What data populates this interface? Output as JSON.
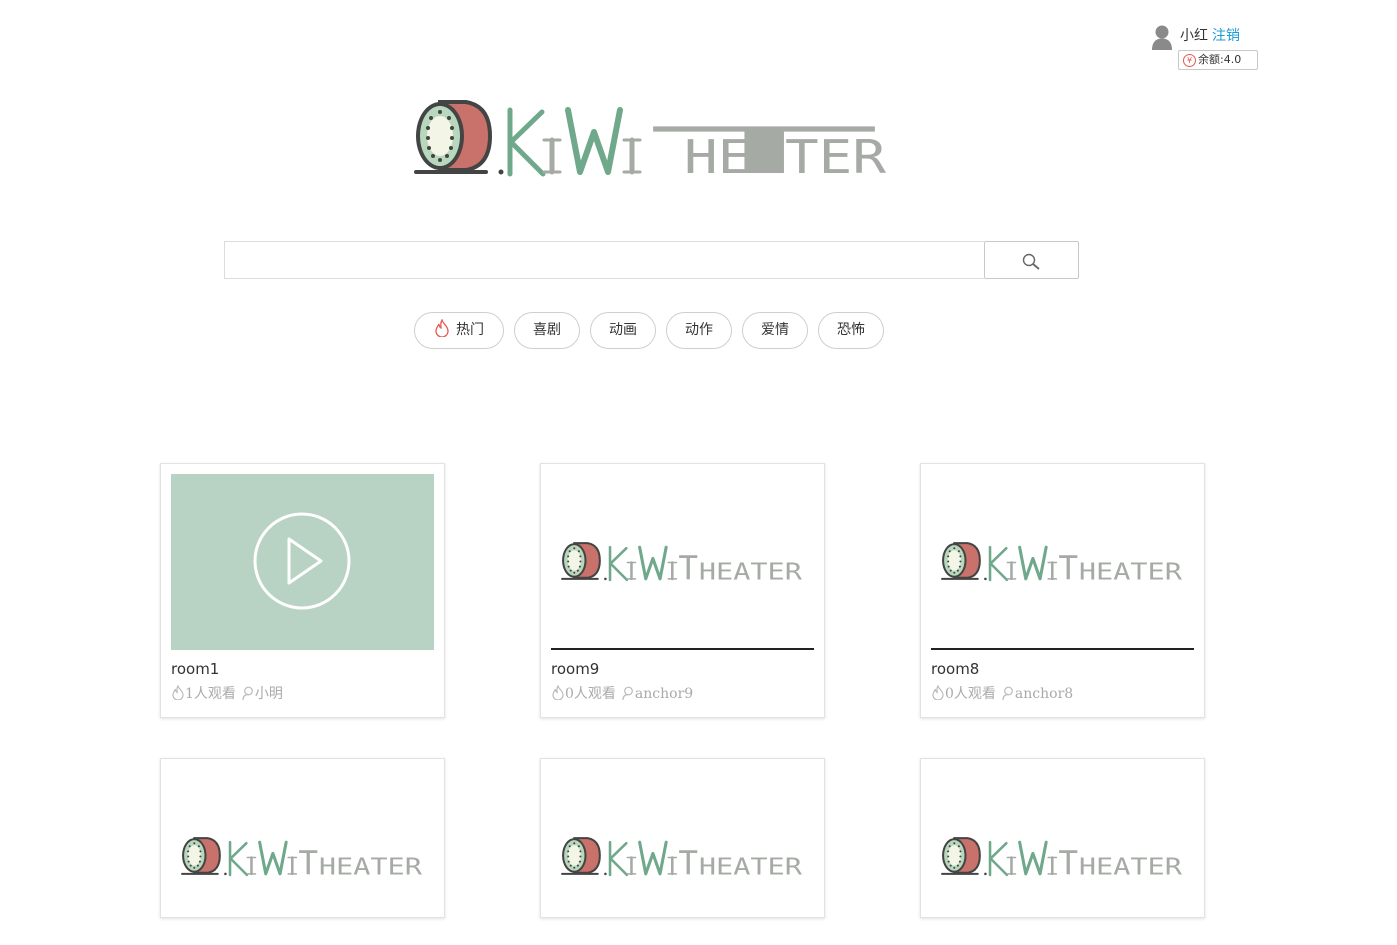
{
  "user": {
    "name": "小红",
    "logout_label": "注销",
    "balance_label": "余额:",
    "balance_value": "4.0"
  },
  "logo": {
    "alt": "KiWiTheater"
  },
  "search": {
    "value": "",
    "placeholder": ""
  },
  "categories": [
    {
      "label": "热门",
      "icon": "fire-icon"
    },
    {
      "label": "喜剧"
    },
    {
      "label": "动画"
    },
    {
      "label": "动作"
    },
    {
      "label": "爱情"
    },
    {
      "label": "恐怖"
    }
  ],
  "rooms": [
    {
      "title": "room1",
      "viewers": "1人观看",
      "anchor": "小明",
      "thumbnail": "play-icon"
    },
    {
      "title": "room9",
      "viewers": "0人观看",
      "anchor": "anchor9",
      "thumbnail": "kiwi-logo"
    },
    {
      "title": "room8",
      "viewers": "0人观看",
      "anchor": "anchor8",
      "thumbnail": "kiwi-logo"
    },
    {
      "title": "",
      "viewers": "",
      "anchor": "",
      "thumbnail": "kiwi-logo"
    },
    {
      "title": "",
      "viewers": "",
      "anchor": "",
      "thumbnail": "kiwi-logo"
    },
    {
      "title": "",
      "viewers": "",
      "anchor": "",
      "thumbnail": "kiwi-logo"
    }
  ],
  "colors": {
    "kiwi_green": "#6fa88b",
    "kiwi_gray": "#a5aaa5",
    "play_bg": "#b8d2c4",
    "link": "#1a9bd7",
    "fire": "#e55a4e"
  }
}
